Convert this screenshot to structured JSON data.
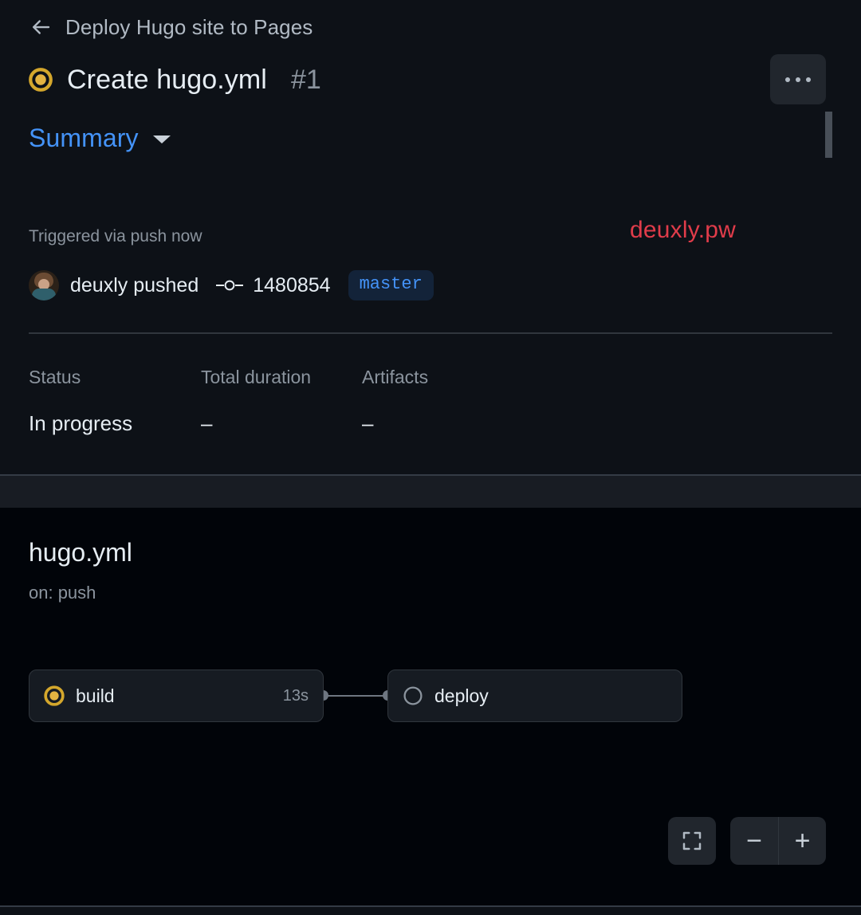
{
  "header": {
    "back_icon": "arrow-left-icon",
    "breadcrumb": "Deploy Hugo site to Pages",
    "status_icon": "in-progress-icon",
    "run_title": "Create hugo.yml",
    "run_number": "#1",
    "kebab_icon": "kebab-horizontal-icon",
    "menu_label": "More options"
  },
  "tabs": {
    "summary_label": "Summary",
    "caret_icon": "chevron-down-icon"
  },
  "trigger": {
    "text": "Triggered via push now",
    "actor": "deuxly pushed",
    "avatar_icon": "avatar",
    "commit_icon": "git-commit-icon",
    "commit_sha": "1480854",
    "branch": "master"
  },
  "watermark": {
    "text": "deuxly.pw",
    "color": "#e03c4a"
  },
  "stats": {
    "columns": [
      {
        "header": "Status",
        "value": "In progress"
      },
      {
        "header": "Total duration",
        "value": "–"
      },
      {
        "header": "Artifacts",
        "value": "–"
      }
    ]
  },
  "graph": {
    "title": "hugo.yml",
    "subtitle": "on: push",
    "jobs": [
      {
        "name": "build",
        "duration": "13s",
        "status": "in-progress",
        "icon": "in-progress-icon"
      },
      {
        "name": "deploy",
        "duration": "",
        "status": "queued",
        "icon": "queued-circle-icon"
      }
    ],
    "controls": {
      "fit_icon": "fit-to-screen-icon",
      "zoom_out_label": "−",
      "zoom_in_label": "+"
    }
  },
  "colors": {
    "in_progress": "#d4a72c",
    "link": "#4493f8",
    "muted": "#8b949e",
    "text": "#e6edf3",
    "panel_bg": "#0d1117",
    "graph_bg": "#010409",
    "node_bg": "#161b22",
    "border": "#30363d"
  }
}
